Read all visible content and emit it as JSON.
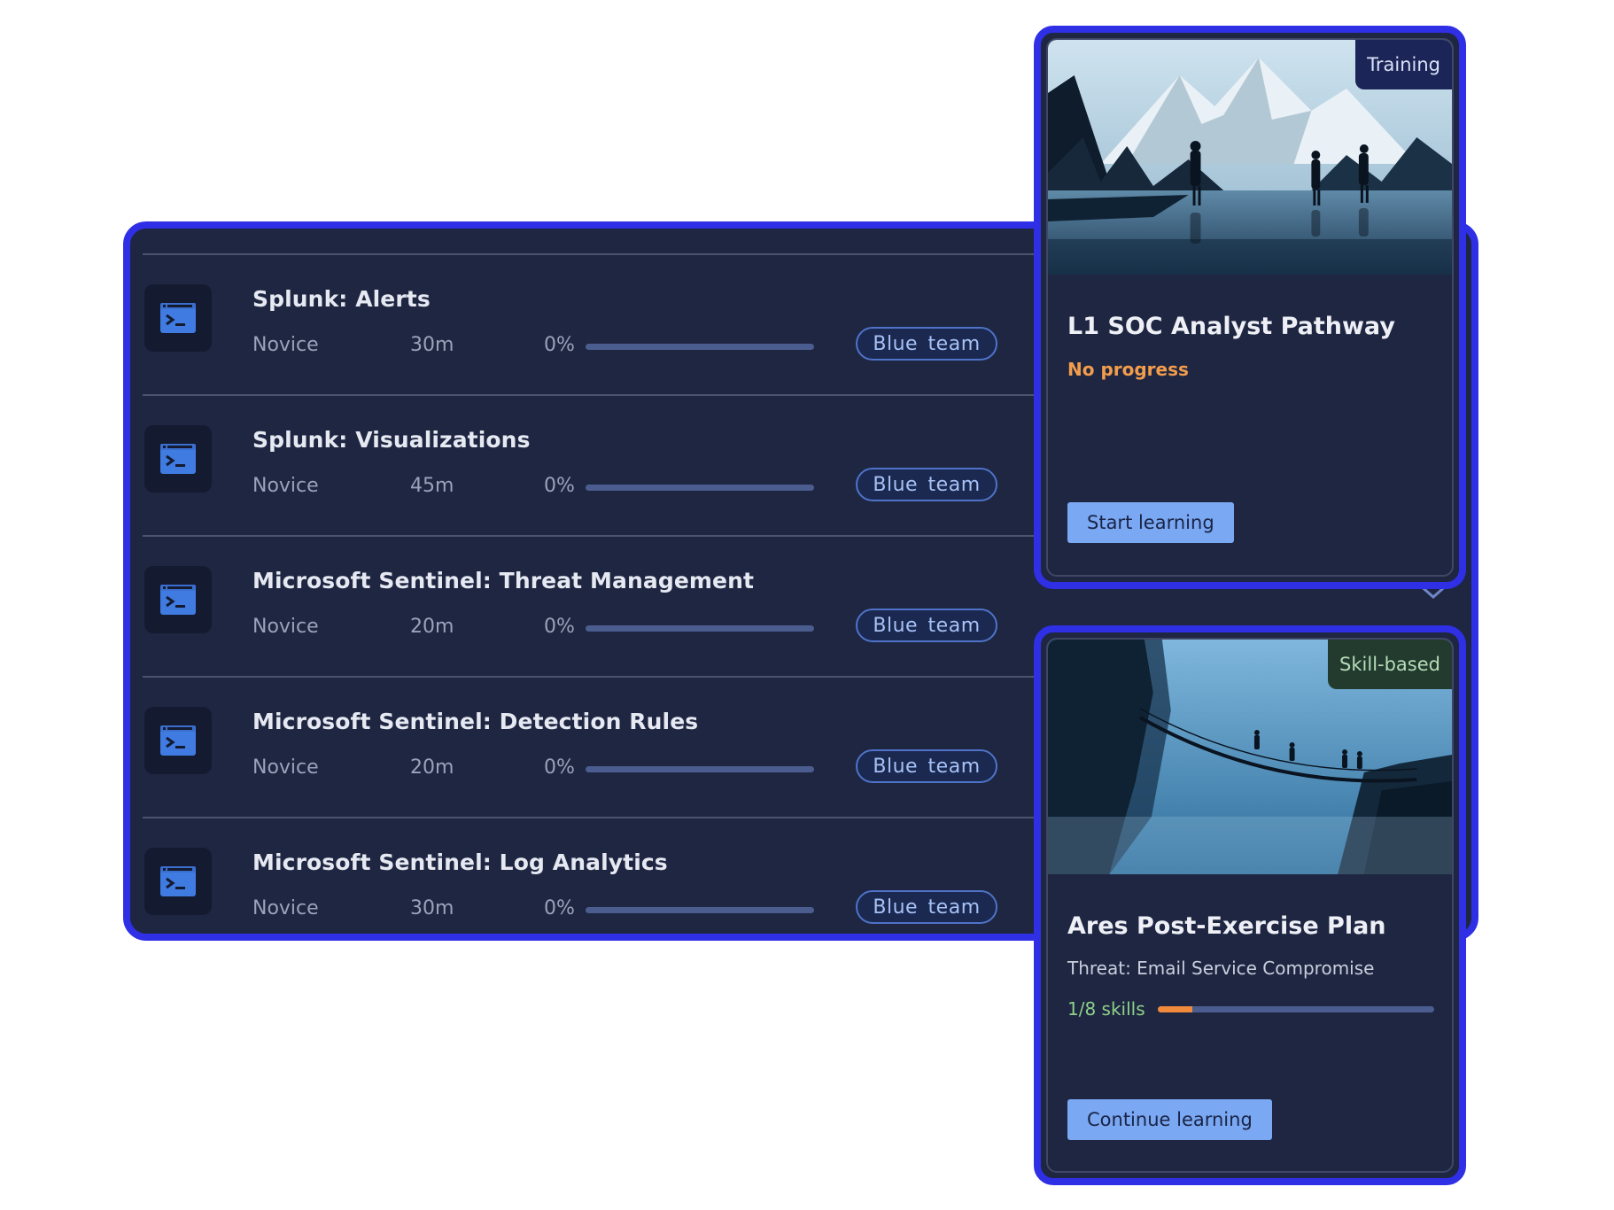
{
  "modules": [
    {
      "title": "Splunk: Alerts",
      "level": "Novice",
      "duration": "30m",
      "progress_label": "0%",
      "progress": 0,
      "tag": "Blue team"
    },
    {
      "title": "Splunk: Visualizations",
      "level": "Novice",
      "duration": "45m",
      "progress_label": "0%",
      "progress": 0,
      "tag": "Blue team"
    },
    {
      "title": "Microsoft Sentinel: Threat Management",
      "level": "Novice",
      "duration": "20m",
      "progress_label": "0%",
      "progress": 0,
      "tag": "Blue team"
    },
    {
      "title": "Microsoft Sentinel: Detection Rules",
      "level": "Novice",
      "duration": "20m",
      "progress_label": "0%",
      "progress": 0,
      "tag": "Blue team"
    },
    {
      "title": "Microsoft Sentinel: Log Analytics",
      "level": "Novice",
      "duration": "30m",
      "progress_label": "0%",
      "progress": 0,
      "tag": "Blue team"
    }
  ],
  "icons": {
    "module": "terminal-window-icon",
    "chevron": "chevron-down-icon"
  },
  "cards": {
    "pathway": {
      "badge": "Training",
      "title": "L1 SOC Analyst Pathway",
      "status": "No progress",
      "button": "Start learning",
      "image": "mountain-lake-hikers-image"
    },
    "plan": {
      "badge": "Skill-based",
      "title": "Ares Post-Exercise Plan",
      "subtitle": "Threat: Email Service Compromise",
      "progress_label": "1/8 skills",
      "progress": 0.125,
      "button": "Continue learning",
      "image": "canyon-bridge-hikers-image"
    }
  },
  "colors": {
    "frame": "#2f2fe6",
    "panel": "#1e2642",
    "accent_orange": "#f08a3c",
    "button": "#7aa8f2",
    "tag_text": "#a6c2f6",
    "status_orange": "#f29d4c",
    "skills_green": "#8fd18a"
  }
}
